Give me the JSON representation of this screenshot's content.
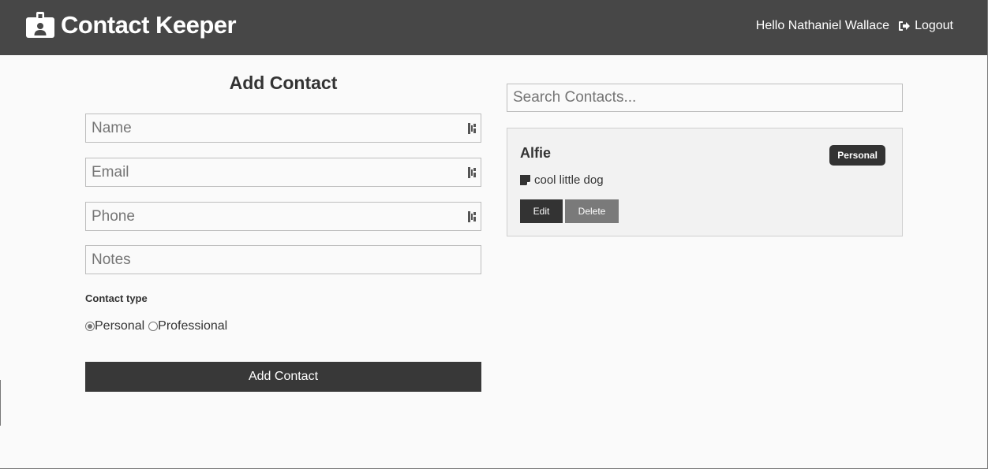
{
  "navbar": {
    "brand_title": "Contact Keeper",
    "brand_icon": "id-badge-icon",
    "greeting": "Hello Nathaniel Wallace",
    "logout_label": "Logout",
    "logout_icon": "sign-out-icon",
    "background_color": "#474747"
  },
  "form": {
    "title": "Add Contact",
    "name_placeholder": "Name",
    "email_placeholder": "Email",
    "phone_placeholder": "Phone",
    "notes_placeholder": "Notes",
    "contact_type_label": "Contact type",
    "type_options": [
      {
        "label": "Personal",
        "selected": true
      },
      {
        "label": "Professional",
        "selected": false
      }
    ],
    "submit_label": "Add Contact"
  },
  "search": {
    "placeholder": "Search Contacts..."
  },
  "contacts": [
    {
      "name": "Alfie",
      "type": "Personal",
      "note": "cool little dog",
      "note_icon": "sticky-note-icon",
      "edit_label": "Edit",
      "delete_label": "Delete"
    }
  ],
  "colors": {
    "dark": "#333333",
    "button_dark": "#383838",
    "delete_gray": "#7a7a7a",
    "card_bg": "#f2f2f2"
  }
}
